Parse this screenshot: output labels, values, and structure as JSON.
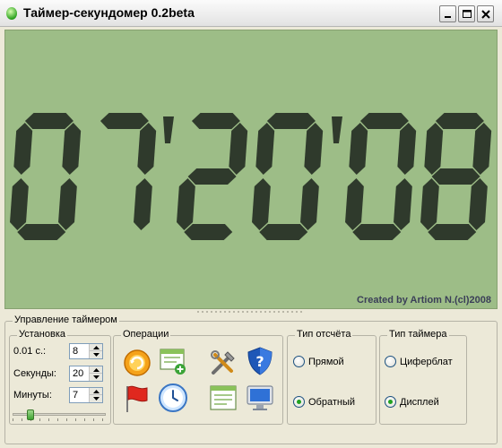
{
  "window": {
    "title": "Таймер-секундомер 0.2beta",
    "icon": "green-orb-icon"
  },
  "display": {
    "time_digits": [
      "0",
      "7",
      "2",
      "0",
      "0",
      "8"
    ],
    "time_text": "07'20'08",
    "credit": "Created by Artiom N.(cl)2008",
    "lcd_color": "#9dbd87",
    "segment_color": "#2f3a2c"
  },
  "control": {
    "title": "Управление таймером",
    "setup": {
      "title": "Установка",
      "rows": [
        {
          "label": "0.01 с.:",
          "value": "8"
        },
        {
          "label": "Секунды:",
          "value": "20"
        },
        {
          "label": "Минуты:",
          "value": "7"
        }
      ],
      "slider_fraction": 0.17
    },
    "operations": {
      "title": "Операции",
      "buttons": [
        "start-icon",
        "add-window-icon",
        "tools-icon",
        "help-shield-icon",
        "flag-icon",
        "clock-icon",
        "window-list-icon",
        "monitor-icon"
      ]
    },
    "count_type": {
      "title": "Тип отсчёта",
      "options": [
        "Прямой",
        "Обратный"
      ],
      "selected": "Обратный"
    },
    "timer_type": {
      "title": "Тип таймера",
      "options": [
        "Циферблат",
        "Дисплей"
      ],
      "selected": "Дисплей"
    }
  }
}
